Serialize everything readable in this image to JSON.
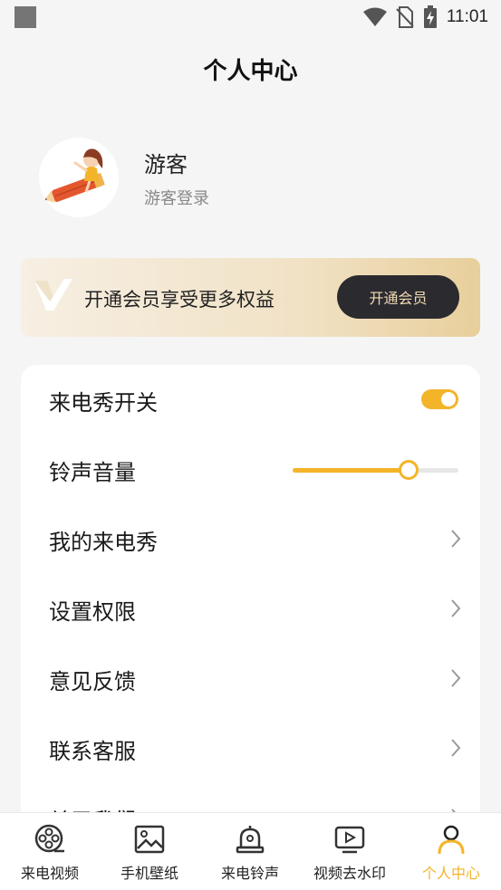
{
  "status_bar": {
    "time": "11:01",
    "icons": [
      "wifi-icon",
      "no-sim-icon",
      "battery-charging-icon"
    ]
  },
  "page": {
    "title": "个人中心"
  },
  "profile": {
    "name": "游客",
    "login_label": "游客登录",
    "avatar_icon": "girl-on-pencil-avatar"
  },
  "vip_banner": {
    "logo_icon": "vip-v-logo",
    "text": "开通会员享受更多权益",
    "button_label": "开通会员"
  },
  "settings": {
    "items": [
      {
        "label": "来电秀开关",
        "control": "toggle",
        "value": true
      },
      {
        "label": "铃声音量",
        "control": "slider",
        "value": 0.7
      },
      {
        "label": "我的来电秀",
        "control": "chevron"
      },
      {
        "label": "设置权限",
        "control": "chevron"
      },
      {
        "label": "意见反馈",
        "control": "chevron"
      },
      {
        "label": "联系客服",
        "control": "chevron"
      },
      {
        "label": "关于我们",
        "control": "chevron"
      }
    ]
  },
  "bottom_nav": {
    "items": [
      {
        "label": "来电视频",
        "icon": "film-reel-icon",
        "active": false
      },
      {
        "label": "手机壁纸",
        "icon": "image-icon",
        "active": false
      },
      {
        "label": "来电铃声",
        "icon": "bell-icon",
        "active": false
      },
      {
        "label": "视频去水印",
        "icon": "video-play-icon",
        "active": false
      },
      {
        "label": "个人中心",
        "icon": "person-icon",
        "active": true
      }
    ]
  },
  "colors": {
    "accent": "#f4b429",
    "background": "#f5f5f5",
    "vip_button": "#2b2a2f",
    "vip_button_text": "#f0dcb4"
  }
}
